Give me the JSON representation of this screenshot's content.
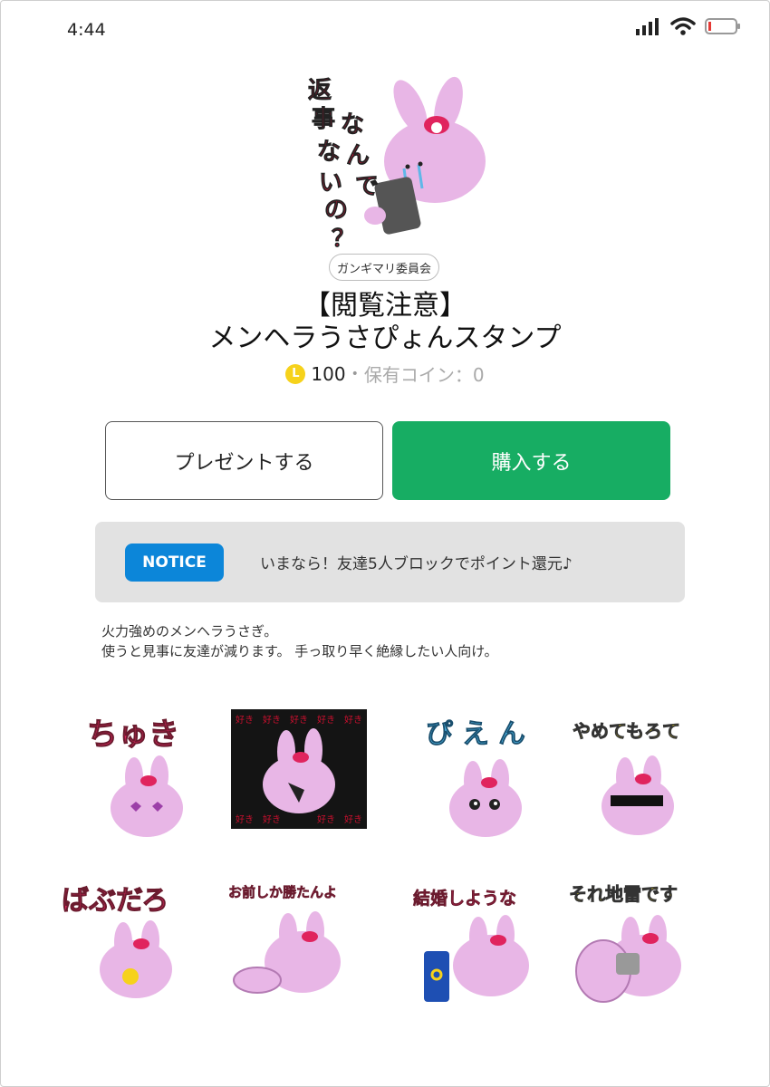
{
  "status_bar": {
    "time": "4:44"
  },
  "hero_sticker": {
    "text_lines": [
      "返",
      "事",
      "な",
      "い",
      "の",
      "？"
    ],
    "text_col2": [
      "な",
      "ん",
      "で"
    ]
  },
  "author": "ガンギマリ委員会",
  "title": {
    "line1": "【閲覧注意】",
    "line2": "メンヘラうさぴょんスタンプ"
  },
  "price": {
    "coin_symbol": "L",
    "value": "100",
    "separator": "•",
    "owned_label": "保有コイン：0"
  },
  "buttons": {
    "present": "プレゼントする",
    "buy": "購入する"
  },
  "notice": {
    "badge": "NOTICE",
    "text": "いまなら！友達5人ブロックでポイント還元♪"
  },
  "description": {
    "line1": "火力強めのメンヘラうさぎ。",
    "line2": "使うと見事に友達が減ります。 手っ取り早く絶縁したい人向け。"
  },
  "stickers": [
    {
      "caption": "ちゅき"
    },
    {
      "caption": "好き"
    },
    {
      "caption": "ぴえん"
    },
    {
      "caption": "やめてもろて"
    },
    {
      "caption": "ばぶだろ"
    },
    {
      "caption": "お前しか勝たんよ"
    },
    {
      "caption": "結婚しような"
    },
    {
      "caption": "それ地雷です"
    }
  ],
  "colors": {
    "buy_green": "#17ad63",
    "notice_blue": "#0c86d9",
    "bunny_pink": "#e8b6e6",
    "accent_red": "#e0245e"
  }
}
